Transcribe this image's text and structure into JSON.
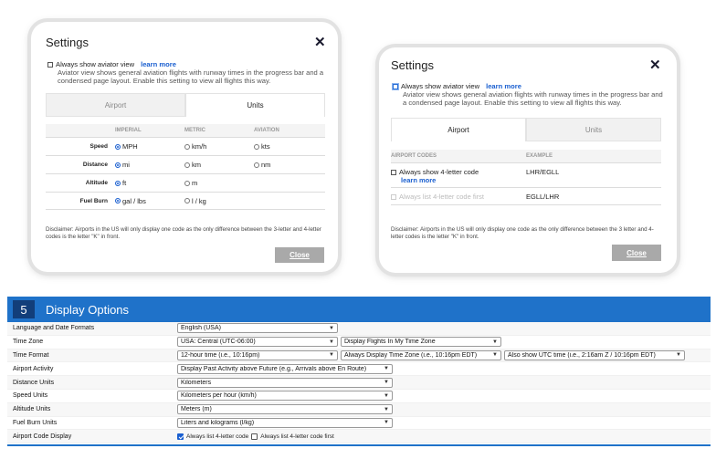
{
  "dialog_units": {
    "title": "Settings",
    "close_glyph": "✕",
    "aviator_checkbox_label": "Always show aviator view",
    "learn_more": "learn more",
    "aviator_desc": "Aviator view shows general aviation flights with runway times in the progress bar and a condensed page layout. Enable this setting to view all flights this way.",
    "tabs": [
      "Airport",
      "Units"
    ],
    "active_tab": "Units",
    "columns": [
      "IMPERIAL",
      "METRIC",
      "AVIATION"
    ],
    "rows": [
      {
        "label": "Speed",
        "options": [
          "MPH",
          "km/h",
          "kts"
        ],
        "selected": 0
      },
      {
        "label": "Distance",
        "options": [
          "mi",
          "km",
          "nm"
        ],
        "selected": 0
      },
      {
        "label": "Altitude",
        "options": [
          "ft",
          "m",
          ""
        ],
        "selected": 0
      },
      {
        "label": "Fuel Burn",
        "options": [
          "gal / lbs",
          "l / kg",
          ""
        ],
        "selected": 0
      }
    ],
    "disclaimer": "Disclaimer: Airports in the US will only display one code as the only difference between the 3-letter and 4-letter codes is the letter \"K\" in front.",
    "close_button": "Close"
  },
  "dialog_airport": {
    "title": "Settings",
    "close_glyph": "✕",
    "aviator_checkbox_label": "Always show aviator view",
    "learn_more": "learn more",
    "aviator_desc": "Aviator view shows general aviation flights with runway times in the progress bar and a condensed page layout. Enable this setting to view all flights this way.",
    "tabs": [
      "Airport",
      "Units"
    ],
    "active_tab": "Airport",
    "columns": [
      "AIRPORT CODES",
      "EXAMPLE"
    ],
    "row1_label": "Always show 4-letter code",
    "row1_link": "learn more",
    "row1_example": "LHR/EGLL",
    "row2_label": "Always list 4-letter code first",
    "row2_example": "EGLL/LHR",
    "disclaimer": "Disclaimer: Airports in the US will only display one code as the only difference between the 3 letter and 4-letter codes is the letter \"K\" in front.",
    "close_button": "Close"
  },
  "display_options": {
    "number": "5",
    "title": "Display Options",
    "rows": [
      {
        "label": "Language and Date Formats",
        "selects": [
          "English (USA)"
        ]
      },
      {
        "label": "Time Zone",
        "selects": [
          "USA: Central (UTC-06:00)",
          "Display Flights In My Time Zone"
        ]
      },
      {
        "label": "Time Format",
        "selects": [
          "12-hour time (i.e., 10:16pm)",
          "Always Display Time Zone (i.e., 10:16pm EDT)",
          "Also show UTC time (i.e., 2:16am Z / 10:16pm EDT)"
        ]
      },
      {
        "label": "Airport Activity",
        "selects": [
          "Display Past Activity above Future (e.g., Arrivals above En Route)"
        ]
      },
      {
        "label": "Distance Units",
        "selects": [
          "Kilometers"
        ]
      },
      {
        "label": "Speed Units",
        "selects": [
          "Kilometers per hour (km/h)"
        ]
      },
      {
        "label": "Altitude Units",
        "selects": [
          "Meters (m)"
        ]
      },
      {
        "label": "Fuel Burn Units",
        "selects": [
          "Liters and kilograms (l/kg)"
        ]
      }
    ],
    "airport_code_row": {
      "label": "Airport Code Display",
      "checkbox1": "Always list 4-letter code",
      "checkbox1_checked": true,
      "checkbox2": "Always list 4-letter code first",
      "checkbox2_checked": false
    },
    "accent_color": "#1f72c9"
  }
}
